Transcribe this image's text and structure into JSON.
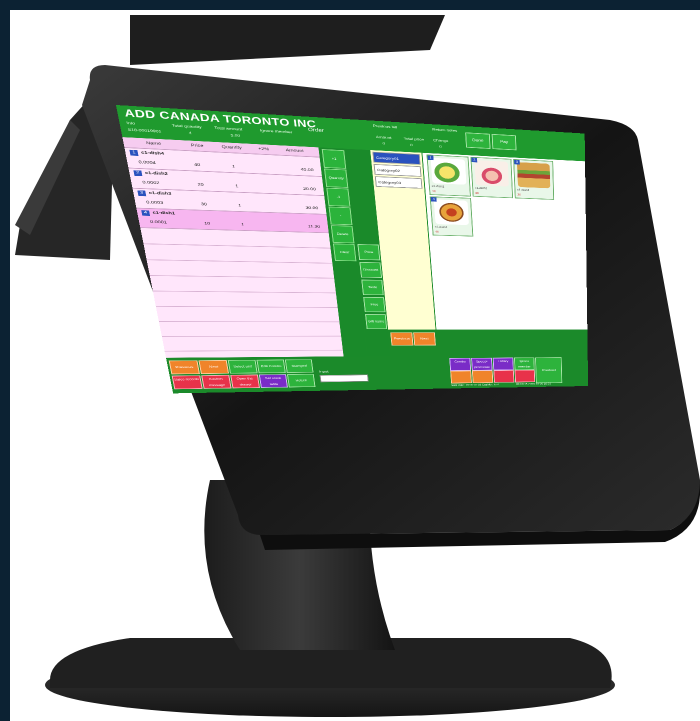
{
  "screen": {
    "company": "ADD CANADA TORONTO INC",
    "header_small": [
      "Info",
      "Total quantity",
      "Total amount",
      "Ignore member",
      "Previous bill",
      "Return notes",
      "Amount",
      "Total price",
      "Change"
    ],
    "header_values": [
      "S18-00019901",
      "4",
      "5.00",
      "0",
      "0",
      "0"
    ],
    "order_label": "Order",
    "top_buttons": [
      "Done",
      "Pay"
    ],
    "columns": [
      "Name",
      "Price",
      "Quantity",
      "+2%",
      "Amount"
    ],
    "items": [
      {
        "num": "1",
        "name": "c1-dish4",
        "id": "0.0004",
        "price": "40",
        "qty": "1",
        "amount": "40.00"
      },
      {
        "num": "2",
        "name": "c1-dish2",
        "id": "0.0002",
        "price": "20",
        "qty": "1",
        "amount": "20.00"
      },
      {
        "num": "3",
        "name": "c1-dish3",
        "id": "0.0003",
        "price": "30",
        "qty": "1",
        "amount": "30.00"
      },
      {
        "num": "4",
        "name": "c1-dish1",
        "id": "0.0001",
        "price": "10",
        "qty": "1",
        "amount": "11.30"
      }
    ],
    "side_buttons": [
      "+1",
      "Quantity",
      "-1",
      "-",
      "Delete",
      "Clear",
      "Price",
      "Discount",
      "Taste",
      "Free",
      "Gift name"
    ],
    "categories": [
      "Category01",
      "Category02",
      "Category03"
    ],
    "products": [
      {
        "tag": "1",
        "name": "c1-dish1",
        "price": "10"
      },
      {
        "tag": "2",
        "name": "c1-dish2",
        "price": "20"
      },
      {
        "tag": "3",
        "name": "c1-dish3",
        "price": "30"
      },
      {
        "tag": "4",
        "name": "c1-dish4",
        "price": "40"
      }
    ],
    "nav_buttons": [
      "Previous",
      "Next"
    ],
    "bottom_buttons_row1": [
      "Previous",
      "Next",
      "Select unit",
      "Edit Combo",
      "Stamped"
    ],
    "bottom_buttons_row2": [
      "Sales records",
      "Kitchen message",
      "Open the drawer",
      "Set stock table",
      "Return"
    ],
    "input_label": "Input",
    "right_buttons": [
      "Combo",
      "Special promotion",
      "Lottery",
      "Ignore member",
      "Checkout"
    ],
    "status_text": [
      "Sale date: 2019-10-03 Cashier: test",
      "00:00:15 2019-10-05 10:31"
    ]
  },
  "colors": {
    "screen_green": "#1b8a2a",
    "order_pink": "#ffe6fb",
    "category_yellow": "#ffffd2",
    "button_orange": "#f0842a",
    "button_red": "#e8324a",
    "button_purple": "#7a2cc7"
  }
}
